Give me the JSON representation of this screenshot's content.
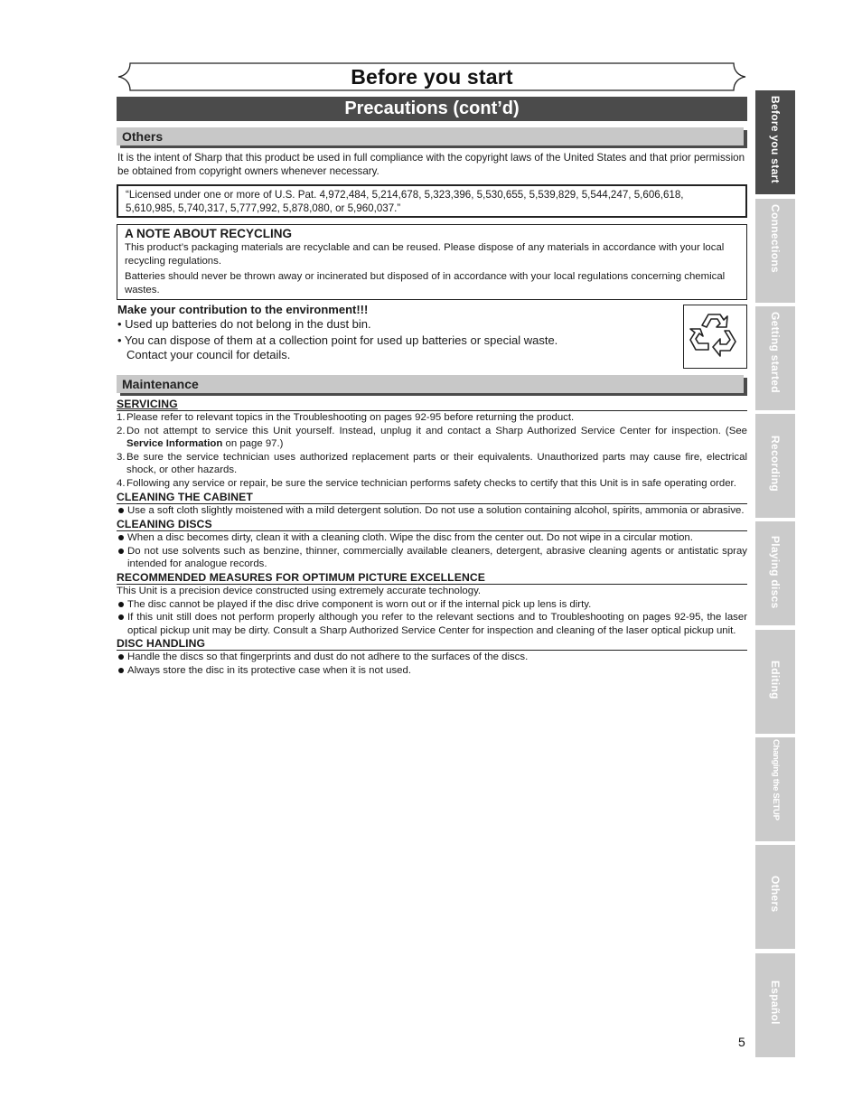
{
  "header": {
    "title": "Before you start",
    "section": "Precautions (cont’d)"
  },
  "others": {
    "heading": "Others",
    "intro": "It is the intent of Sharp that this product be used in full compliance with the copyright laws of the United States and that prior permission be obtained from copyright owners whenever necessary.",
    "license_line1": "“Licensed under one or more of U.S. Pat. 4,972,484, 5,214,678, 5,323,396, 5,530,655, 5,539,829, 5,544,247, 5,606,618,",
    "license_line2": "5,610,985, 5,740,317, 5,777,992, 5,878,080, or 5,960,037.”"
  },
  "recycling": {
    "title": "A NOTE ABOUT RECYCLING",
    "para1": "This product’s packaging materials are recyclable and can be reused. Please dispose of any materials in accordance with your local recycling regulations.",
    "para2": "Batteries should never be thrown away or incinerated but disposed of in accordance with your local regulations concerning chemical wastes."
  },
  "contribution": {
    "title": "Make your contribution to the environment!!!",
    "bullets": [
      "• Used up batteries do not belong in the dust bin.",
      "• You can dispose of them at a collection point for used up batteries or special waste."
    ],
    "continuation": "Contact your council for details.",
    "icon": "recycle-icon"
  },
  "maintenance": {
    "heading": "Maintenance",
    "servicing": {
      "heading": "SERVICING",
      "items": [
        {
          "num": "1.",
          "text": "Please refer to relevant topics in the Troubleshooting on pages 92-95 before returning the product."
        },
        {
          "num": "2.",
          "text_before": "Do not attempt to service this Unit yourself. Instead, unplug it and contact a Sharp Authorized Service Center for inspection. (See ",
          "bold": "Service Information",
          "text_after": " on page 97.)"
        },
        {
          "num": "3.",
          "text": "Be sure the service technician uses authorized replacement parts or their equivalents. Unauthorized parts may cause fire, electrical shock, or other hazards."
        },
        {
          "num": "4.",
          "text": "Following any service or repair, be sure the service technician performs safety checks to certify that this Unit is in safe operating order."
        }
      ]
    },
    "cabinet": {
      "heading": "CLEANING THE CABINET",
      "bullets": [
        "Use a soft cloth slightly moistened with a mild detergent solution. Do not use a solution containing alcohol, spirits, ammonia or abrasive."
      ]
    },
    "discs": {
      "heading": "CLEANING DISCS",
      "bullets": [
        "When a disc becomes dirty, clean it with a cleaning cloth. Wipe the disc from the center out. Do not wipe in a circular motion.",
        "Do not use solvents such as benzine, thinner, commercially available cleaners, detergent, abrasive cleaning agents or antistatic spray intended for analogue records."
      ]
    },
    "picture": {
      "heading": "RECOMMENDED MEASURES FOR OPTIMUM PICTURE EXCELLENCE",
      "intro": "This Unit is a precision device constructed using extremely accurate technology.",
      "bullets": [
        "The disc cannot be played if the disc drive component is worn out or if the internal pick up lens is dirty.",
        "If this unit still does not perform properly although you refer to the relevant sections and to Troubleshooting  on pages 92-95, the laser optical pickup unit may be dirty. Consult a Sharp Authorized Service Center for inspection and cleaning of the laser optical pickup unit."
      ]
    },
    "handling": {
      "heading": "DISC HANDLING",
      "bullets": [
        "Handle the discs so that fingerprints and dust do not adhere to the surfaces of the discs.",
        "Always store the disc in its protective case when it is not used."
      ]
    }
  },
  "side_tabs": [
    {
      "label": "Before you start",
      "active": true
    },
    {
      "label": "Connections",
      "active": false
    },
    {
      "label": "Getting started",
      "active": false
    },
    {
      "label": "Recording",
      "active": false
    },
    {
      "label": "Playing discs",
      "active": false
    },
    {
      "label": "Editing",
      "active": false
    },
    {
      "label": "Changing the SETUP menu",
      "active": false
    },
    {
      "label": "Others",
      "active": false
    },
    {
      "label": "Español",
      "active": false
    }
  ],
  "page_number": "5",
  "colors": {
    "dark_bar": "#4b4b4b",
    "light_bar": "#c8c8c8",
    "tab_inactive": "#cbcbcb"
  }
}
